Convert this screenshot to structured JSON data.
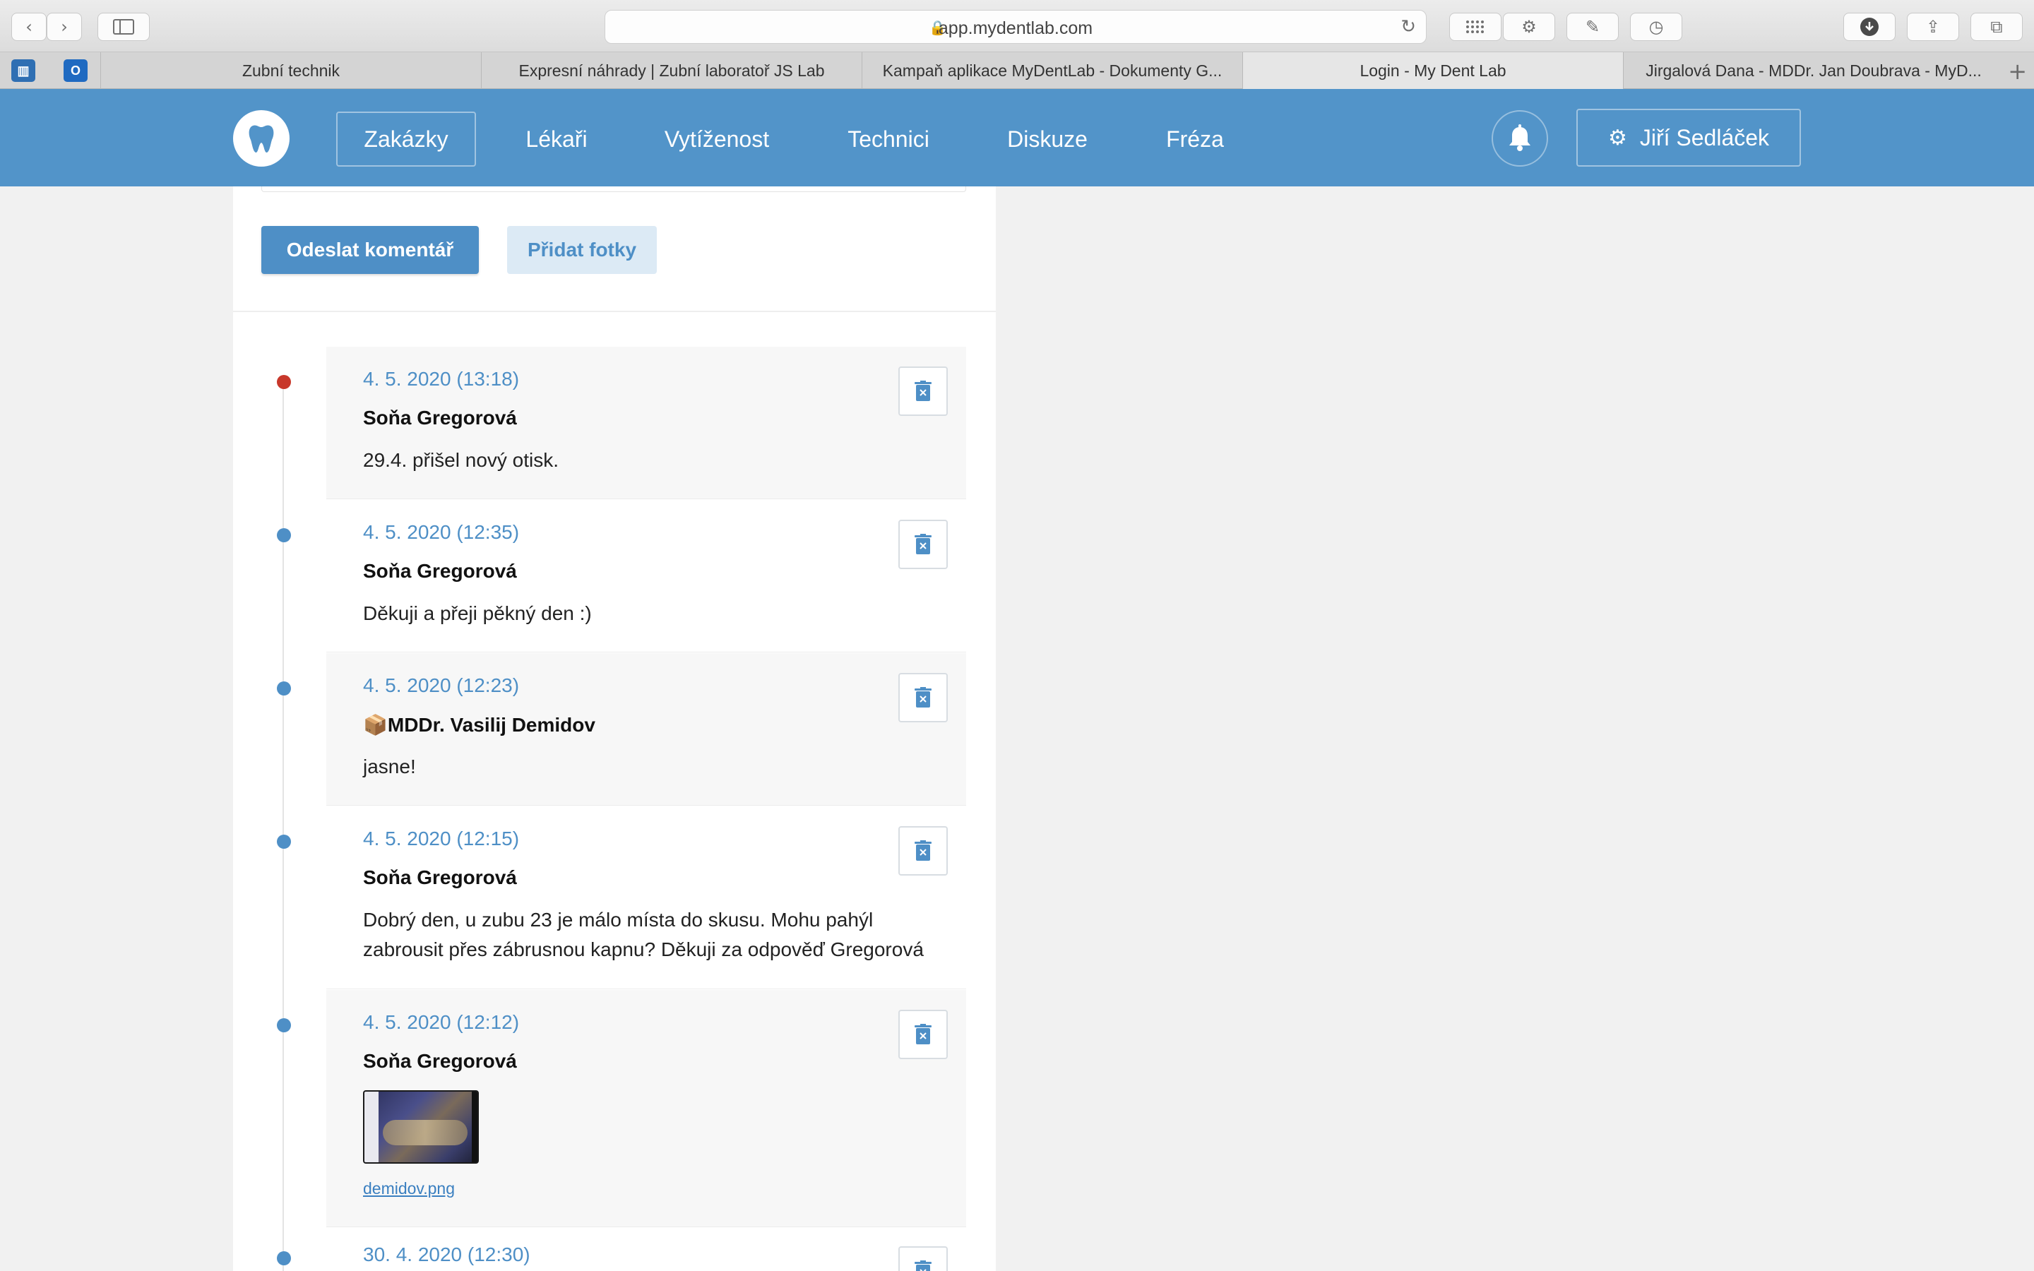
{
  "browser": {
    "url": "app.mydentlab.com",
    "tabs": [
      {
        "label": "Zubní technik"
      },
      {
        "label": "Expresní náhrady | Zubní laboratoř JS Lab"
      },
      {
        "label": "Kampaň aplikace MyDentLab - Dokumenty G..."
      },
      {
        "label": "Login - My Dent Lab"
      },
      {
        "label": "Jirgalová Dana - MDDr. Jan Doubrava - MyD..."
      }
    ]
  },
  "nav": {
    "items": [
      {
        "label": "Zakázky"
      },
      {
        "label": "Lékaři"
      },
      {
        "label": "Vytíženost"
      },
      {
        "label": "Technici"
      },
      {
        "label": "Diskuze"
      },
      {
        "label": "Fréza"
      }
    ],
    "user": "Jiří Sedláček"
  },
  "comment_form": {
    "send_label": "Odeslat komentář",
    "photos_label": "Přidat fotky"
  },
  "comments": [
    {
      "date": "4. 5. 2020 (13:18)",
      "author": "Soňa Gregorová",
      "text": "29.4. přišel nový otisk.",
      "dot_color": "#c8382b"
    },
    {
      "date": "4. 5. 2020 (12:35)",
      "author": "Soňa Gregorová",
      "text": "Děkuji a přeji pěkný den :)",
      "dot_color": "#4e8fc6"
    },
    {
      "date": "4. 5. 2020 (12:23)",
      "author": "📦MDDr. Vasilij Demidov",
      "text": "jasne!",
      "dot_color": "#4e8fc6"
    },
    {
      "date": "4. 5. 2020 (12:15)",
      "author": "Soňa Gregorová",
      "text": "Dobrý den, u zubu 23 je málo místa do skusu. Mohu pahýl zabrousit přes zábrusnou kapnu? Děkuji za odpověď Gregorová",
      "dot_color": "#4e8fc6"
    },
    {
      "date": "4. 5. 2020 (12:12)",
      "author": "Soňa Gregorová",
      "attachment": "demidov.png",
      "dot_color": "#4e8fc6"
    },
    {
      "date": "30. 4. 2020 (12:30)",
      "dot_color": "#4e8fc6"
    }
  ],
  "colors": {
    "brand": "#5294c9",
    "accent": "#4e8fc6",
    "unread_dot": "#c8382b"
  }
}
